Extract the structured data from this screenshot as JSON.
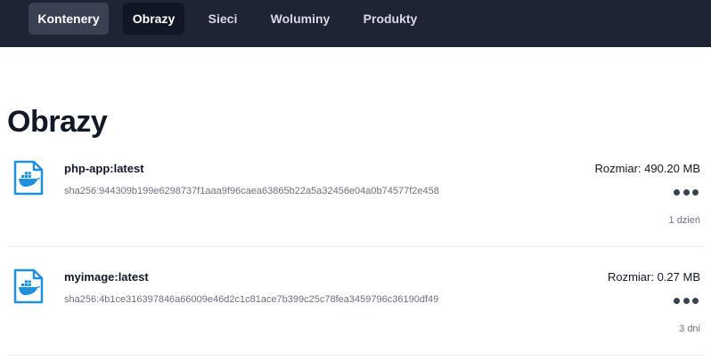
{
  "nav": {
    "items": [
      {
        "label": "Kontenery"
      },
      {
        "label": "Obrazy"
      },
      {
        "label": "Sieci"
      },
      {
        "label": "Woluminy"
      },
      {
        "label": "Produkty"
      }
    ],
    "active": "Obrazy"
  },
  "page": {
    "title": "Obrazy"
  },
  "images": [
    {
      "name": "php-app:latest",
      "digest": "sha256:944309b199e6298737f1aaa9f96caea63865b22a5a32456e04a0b74577f2e458",
      "size": "Rozmiar: 490.20 MB",
      "age": "1 dzień",
      "icon": "docker-image-file-icon"
    },
    {
      "name": "myimage:latest",
      "digest": "sha256:4b1ce316397846a66009e46d2c1c81ace7b399c25c78fea3459796c36190df49",
      "size": "Rozmiar: 0.27 MB",
      "age": "3 dni",
      "icon": "docker-image-file-icon"
    }
  ],
  "colors": {
    "nav_bg": "#1e2433",
    "nav_active_bg": "#101623",
    "icon_blue": "#1d91e0"
  }
}
